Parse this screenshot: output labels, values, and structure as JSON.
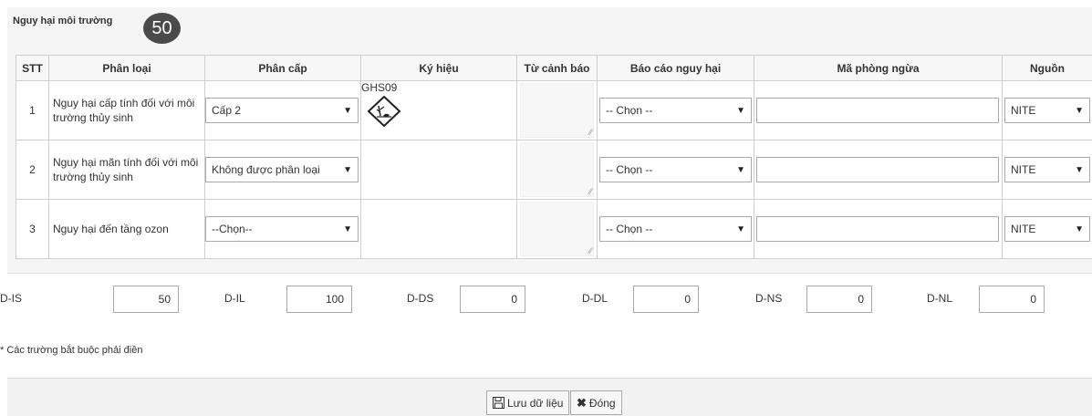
{
  "section": {
    "title": "Nguy hại môi trường",
    "badge": "50"
  },
  "table": {
    "headers": [
      "STT",
      "Phân loại",
      "Phân cấp",
      "Ký hiệu",
      "Từ cảnh báo",
      "Báo cáo nguy hại",
      "Mã phòng ngừa",
      "Nguồn"
    ],
    "rows": [
      {
        "stt": "1",
        "classification": "Nguy hại cấp tính đối với môi trường thủy sinh",
        "category": "Cấp 2",
        "symbol_code": "GHS09",
        "symbol_icon": "environment-hazard-pictogram-icon",
        "hazard_report": "-- Chọn --",
        "prevention_code": "",
        "source": "NITE"
      },
      {
        "stt": "2",
        "classification": "Nguy hại mãn tính đối với môi trường thủy sinh",
        "category": "Không được phân loại",
        "symbol_code": "",
        "hazard_report": "-- Chọn --",
        "prevention_code": "",
        "source": "NITE"
      },
      {
        "stt": "3",
        "classification": "Nguy hại đến tầng ozon",
        "category": "--Chọn--",
        "symbol_code": "",
        "hazard_report": "-- Chọn --",
        "prevention_code": "",
        "source": "NITE"
      }
    ]
  },
  "metrics": [
    {
      "label": "D-IS",
      "value": "50"
    },
    {
      "label": "D-IL",
      "value": "100"
    },
    {
      "label": "D-DS",
      "value": "0"
    },
    {
      "label": "D-DL",
      "value": "0"
    },
    {
      "label": "D-NS",
      "value": "0"
    },
    {
      "label": "D-NL",
      "value": "0"
    }
  ],
  "note": "* Các trường bắt buộc phải điền",
  "footer": {
    "save_label": "Lưu dữ liệu",
    "save_icon": "save-icon",
    "close_label": "Đóng",
    "close_icon": "close-icon"
  }
}
